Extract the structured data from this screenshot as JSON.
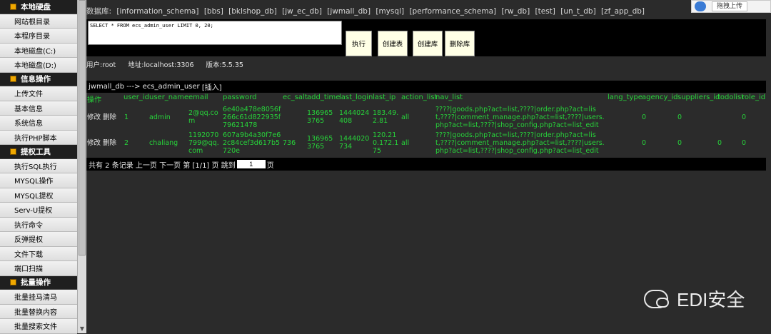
{
  "sidebar": {
    "sections": [
      {
        "title": "本地硬盘",
        "items": [
          "网站根目录",
          "本程序目录",
          "本地磁盘(C:)",
          "本地磁盘(D:)"
        ]
      },
      {
        "title": "信息操作",
        "items": [
          "上传文件",
          "基本信息",
          "系统信息",
          "执行PHP脚本"
        ]
      },
      {
        "title": "提权工具",
        "items": [
          "执行SQL执行",
          "MYSQL操作",
          "MYSQL提权",
          "Serv-U提权",
          "执行命令",
          "反弹提权",
          "文件下载",
          "端口扫描"
        ]
      },
      {
        "title": "批量操作",
        "items": [
          "批量挂马清马",
          "批量替换内容",
          "批量搜索文件"
        ]
      }
    ]
  },
  "db_bar": {
    "label": "数据库:",
    "databases": [
      "[information_schema]",
      "[bbs]",
      "[bklshop_db]",
      "[jw_ec_db]",
      "[jwmall_db]",
      "[mysql]",
      "[performance_schema]",
      "[rw_db]",
      "[test]",
      "[un_t_db]",
      "[zf_app_db]"
    ]
  },
  "sql": {
    "query": "SELECT * FROM ecs_admin_user LIMIT 0, 20;",
    "buttons": [
      "执行",
      "创建表",
      "创建库",
      "删除库"
    ]
  },
  "info": {
    "user": "用户:root",
    "address": "地址:localhost:3306",
    "version": "版本:5.5.35"
  },
  "table": {
    "path": "jwmall_db ---> ecs_admin_user",
    "insert": "[插入]",
    "headers": [
      "操作",
      "user_id",
      "user_name",
      "email",
      "password",
      "ec_salt",
      "add_time",
      "last_login",
      "last_ip",
      "action_list",
      "nav_list",
      "lang_type",
      "agency_id",
      "suppliers_id",
      "todolist",
      "role_id"
    ],
    "rows": [
      {
        "ops": "修改 删除",
        "user_id": "1",
        "user_name": "admin",
        "email": "2@qq.com",
        "password": "6e40a478e8056f266c61d822935f79621478",
        "ec_salt": "",
        "add_time": "1369653765",
        "last_login": "1444024408",
        "last_ip": "183.49.2.81",
        "action_list": "all",
        "nav_list": "????|goods.php?act=list,????|order.php?act=list,????|comment_manage.php?act=list,????|users.php?act=list,????|shop_config.php?act=list_edit",
        "lang_type": "",
        "agency_id": "0",
        "suppliers_id": "0",
        "todolist": "",
        "role_id": "0"
      },
      {
        "ops": "修改 删除",
        "user_id": "2",
        "user_name": "chaliang",
        "email": "1192070799@qq.com",
        "password": "607a9b4a30f7e62c84cef3d617b5720e",
        "ec_salt": "736",
        "add_time": "1369653765",
        "last_login": "1444020734",
        "last_ip": "120.210.172.175",
        "action_list": "all",
        "nav_list": "????|goods.php?act=list,????|order.php?act=list,????|comment_manage.php?act=list,????|users.php?act=list,????|shop_config.php?act=list_edit",
        "lang_type": "",
        "agency_id": "0",
        "suppliers_id": "0",
        "todolist": "0",
        "role_id": "0"
      }
    ]
  },
  "pager": {
    "text_before": "共有 2 条记录 上一页 下一页 第 [1/1] 页 跳到",
    "page_value": "1",
    "text_after": "页"
  },
  "upload": {
    "label": "拖拽上传"
  },
  "watermark": {
    "text": "EDI安全"
  }
}
